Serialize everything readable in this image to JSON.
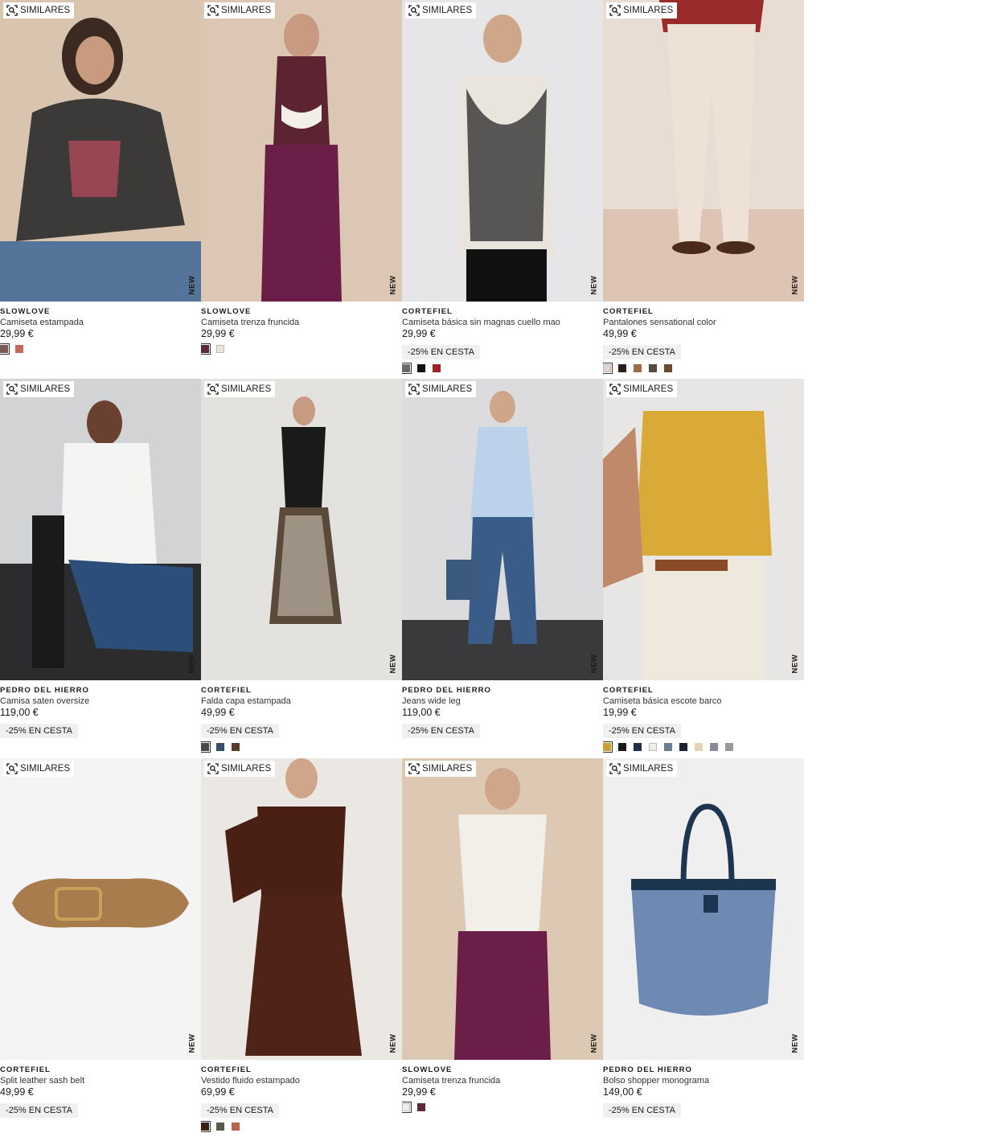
{
  "ui": {
    "similar_label": "SIMILARES",
    "new_label": "NEW"
  },
  "products": [
    {
      "brand": "SLOWLOVE",
      "name": "Camiseta estampada",
      "price": "29,99 €",
      "promo": "",
      "art": "tee",
      "bg": "#d9c4b0",
      "colors": [
        "#7a5a55",
        "#c46a5a"
      ]
    },
    {
      "brand": "SLOWLOVE",
      "name": "Camiseta trenza fruncida",
      "price": "29,99 €",
      "promo": "",
      "art": "dress",
      "bg": "#dcc6b4",
      "colors": [
        "#5a2a35",
        "#ece4dc"
      ]
    },
    {
      "brand": "CORTEFIEL",
      "name": "Camiseta básica sin magnas cuello mao",
      "price": "29,99 €",
      "promo": "-25% EN CESTA",
      "art": "blouse",
      "bg": "#e6e6e8",
      "colors": [
        "#6a6a6a",
        "#111111",
        "#9b2323"
      ]
    },
    {
      "brand": "CORTEFIEL",
      "name": "Pantalones sensational color",
      "price": "49,99 €",
      "promo": "-25% EN CESTA",
      "art": "pants",
      "bg": "#e9dcd2",
      "colors": [
        "#e2d6cc",
        "#2a1f1a",
        "#9a6a4a",
        "#5a4a3a",
        "#6a4a2a"
      ]
    },
    {
      "brand": "PEDRO DEL HIERRO",
      "name": "Camisa saten oversize",
      "price": "119,00 €",
      "promo": "-25% EN CESTA",
      "art": "shirt",
      "bg": "#d2d3d5",
      "colors": []
    },
    {
      "brand": "CORTEFIEL",
      "name": "Falda capa estampada",
      "price": "49,99 €",
      "promo": "-25% EN CESTA",
      "art": "skirt",
      "bg": "#e4e2df",
      "colors": [
        "#4a4a4a",
        "#33506a",
        "#5a3a2a"
      ]
    },
    {
      "brand": "PEDRO DEL HIERRO",
      "name": "Jeans wide leg",
      "price": "119,00 €",
      "promo": "-25% EN CESTA",
      "art": "jeans",
      "bg": "#dcdcde",
      "colors": []
    },
    {
      "brand": "CORTEFIEL",
      "name": "Camiseta básica escote barco",
      "price": "19,99 €",
      "promo": "-25% EN CESTA",
      "art": "yellow",
      "bg": "#e8e6e4",
      "colors": [
        "#c9a032",
        "#1a1a1a",
        "#1f2f4a",
        "#ececec",
        "#6a7e96",
        "#1c2433",
        "#e6d2b8",
        "#8a8a96",
        "#9a9a9a"
      ]
    },
    {
      "brand": "CORTEFIEL",
      "name": "Split leather sash belt",
      "price": "49,99 €",
      "promo": "-25% EN CESTA",
      "art": "belt",
      "bg": "#f4f4f4",
      "colors": []
    },
    {
      "brand": "CORTEFIEL",
      "name": "Vestido fluido estampado",
      "price": "69,99 €",
      "promo": "-25% EN CESTA",
      "art": "brown",
      "bg": "#ebe7e2",
      "colors": [
        "#3a1f14",
        "#5a5a48",
        "#b8644a"
      ]
    },
    {
      "brand": "SLOWLOVE",
      "name": "Camiseta trenza fruncida",
      "price": "29,99 €",
      "promo": "",
      "art": "white",
      "bg": "#ddc8b4",
      "colors": [
        "#f0ece6",
        "#5a2a35"
      ]
    },
    {
      "brand": "PEDRO DEL HIERRO",
      "name": "Bolso shopper monograma",
      "price": "149,00 €",
      "promo": "-25% EN CESTA",
      "art": "bag",
      "bg": "#efefef",
      "colors": []
    }
  ]
}
